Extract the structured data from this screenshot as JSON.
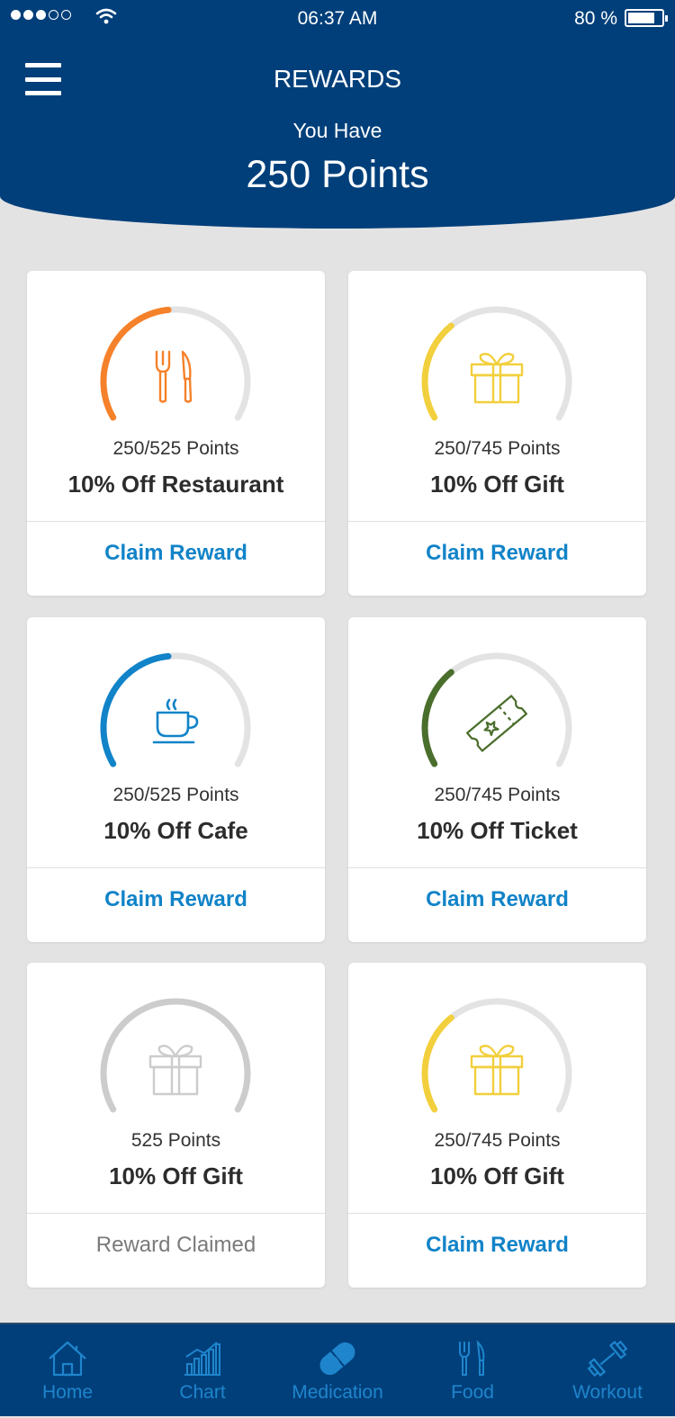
{
  "status_bar": {
    "time": "06:37 AM",
    "battery": "80 %",
    "battery_level": 0.8,
    "signal_bars_filled": 3,
    "signal_bars_total": 5
  },
  "header": {
    "title": "REWARDS",
    "subtitle": "You Have",
    "points": "250 Points"
  },
  "rewards": [
    {
      "points": "250/525 Points",
      "name": "10% Off Restaurant",
      "action": "Claim Reward",
      "icon": "fork-knife-icon",
      "color": "#f5812a",
      "progress": 0.476
    },
    {
      "points": "250/745 Points",
      "name": "10% Off Gift",
      "action": "Claim Reward",
      "icon": "gift-icon",
      "color": "#f2cf3c",
      "progress": 0.336
    },
    {
      "points": "250/525 Points",
      "name": "10% Off Cafe",
      "action": "Claim Reward",
      "icon": "coffee-cup-icon",
      "color": "#1183c8",
      "progress": 0.476
    },
    {
      "points": "250/745 Points",
      "name": "10% Off Ticket",
      "action": "Claim Reward",
      "icon": "ticket-icon",
      "color": "#4a6e2c",
      "progress": 0.336
    },
    {
      "points": "525 Points",
      "name": "10% Off Gift",
      "action": "Reward Claimed",
      "icon": "gift-icon",
      "color": "#cccccc",
      "progress": 1.0
    },
    {
      "points": "250/745 Points",
      "name": "10% Off Gift",
      "action": "Claim Reward",
      "icon": "gift-icon",
      "color": "#f2cf3c",
      "progress": 0.336
    }
  ],
  "nav": [
    {
      "label": "Home",
      "icon": "home-icon"
    },
    {
      "label": "Chart",
      "icon": "chart-icon"
    },
    {
      "label": "Medication",
      "icon": "pill-icon"
    },
    {
      "label": "Food",
      "icon": "fork-knife-icon"
    },
    {
      "label": "Workout",
      "icon": "dumbbell-icon"
    }
  ],
  "colors": {
    "header_bg": "#003f7a",
    "page_bg": "#e4e3e4",
    "link": "#1183c8",
    "nav_icon": "#1f85cc",
    "track": "#e3e3e3"
  }
}
